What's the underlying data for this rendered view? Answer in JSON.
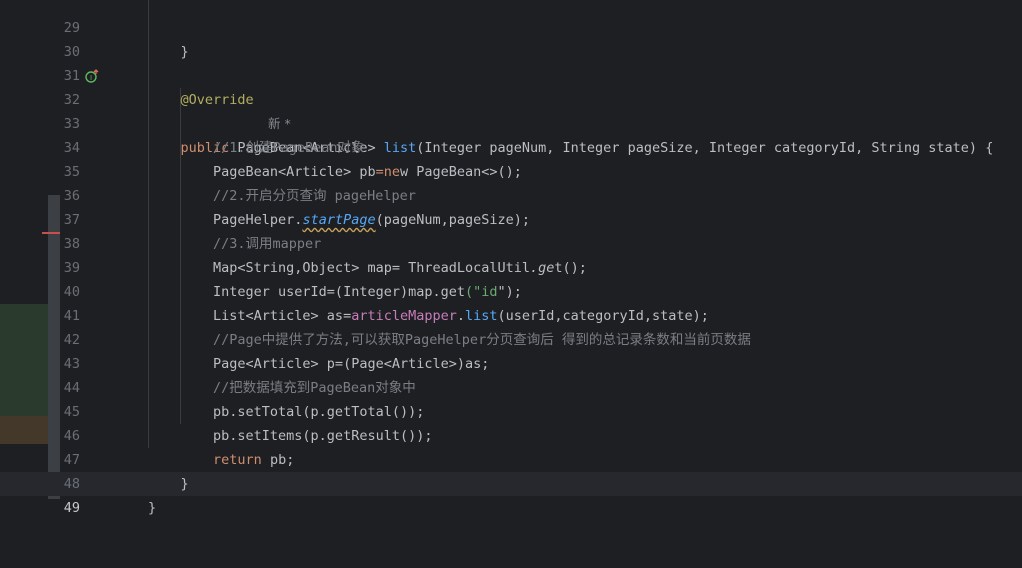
{
  "editor": {
    "current_line": "49",
    "annotation_hint": "新 *",
    "lines": [
      {
        "n": "29",
        "t": "    }"
      },
      {
        "n": "30",
        "t": ""
      },
      {
        "n": "31",
        "t": "    @Override"
      },
      {
        "n": "32",
        "t": "    public PageBean<Article> list(Integer pageNum, Integer pageSize, Integer categoryId, String state) {"
      },
      {
        "n": "33",
        "t": "        //1.创建PageBean对象"
      },
      {
        "n": "34",
        "t": "        PageBean<Article> pb=new PageBean<>();"
      },
      {
        "n": "35",
        "t": "        //2.开启分页查询 pageHelper"
      },
      {
        "n": "36",
        "t": "        PageHelper.startPage(pageNum,pageSize);"
      },
      {
        "n": "37",
        "t": "        //3.调用mapper"
      },
      {
        "n": "38",
        "t": "        Map<String,Object> map= ThreadLocalUtil.get();"
      },
      {
        "n": "39",
        "t": "        Integer userId=(Integer)map.get(\"id\");"
      },
      {
        "n": "40",
        "t": "        List<Article> as=articleMapper.list(userId,categoryId,state);"
      },
      {
        "n": "41",
        "t": "        //Page中提供了方法,可以获取PageHelper分页查询后 得到的总记录条数和当前页数据"
      },
      {
        "n": "42",
        "t": "        Page<Article> p=(Page<Article>)as;"
      },
      {
        "n": "43",
        "t": "        //把数据填充到PageBean对象中"
      },
      {
        "n": "44",
        "t": "        pb.setTotal(p.getTotal());"
      },
      {
        "n": "45",
        "t": "        pb.setItems(p.getResult());"
      },
      {
        "n": "46",
        "t": "        return pb;"
      },
      {
        "n": "47",
        "t": "    }"
      },
      {
        "n": "48",
        "t": "}"
      },
      {
        "n": "49",
        "t": ""
      }
    ]
  },
  "colors": {
    "background": "#1e1f22",
    "keyword": "#cf8e6d",
    "function": "#56a8f5",
    "annotation": "#b3ae60",
    "comment": "#7a7e85",
    "string": "#6aab73",
    "field": "#c77dbb",
    "text": "#bcbec4"
  }
}
